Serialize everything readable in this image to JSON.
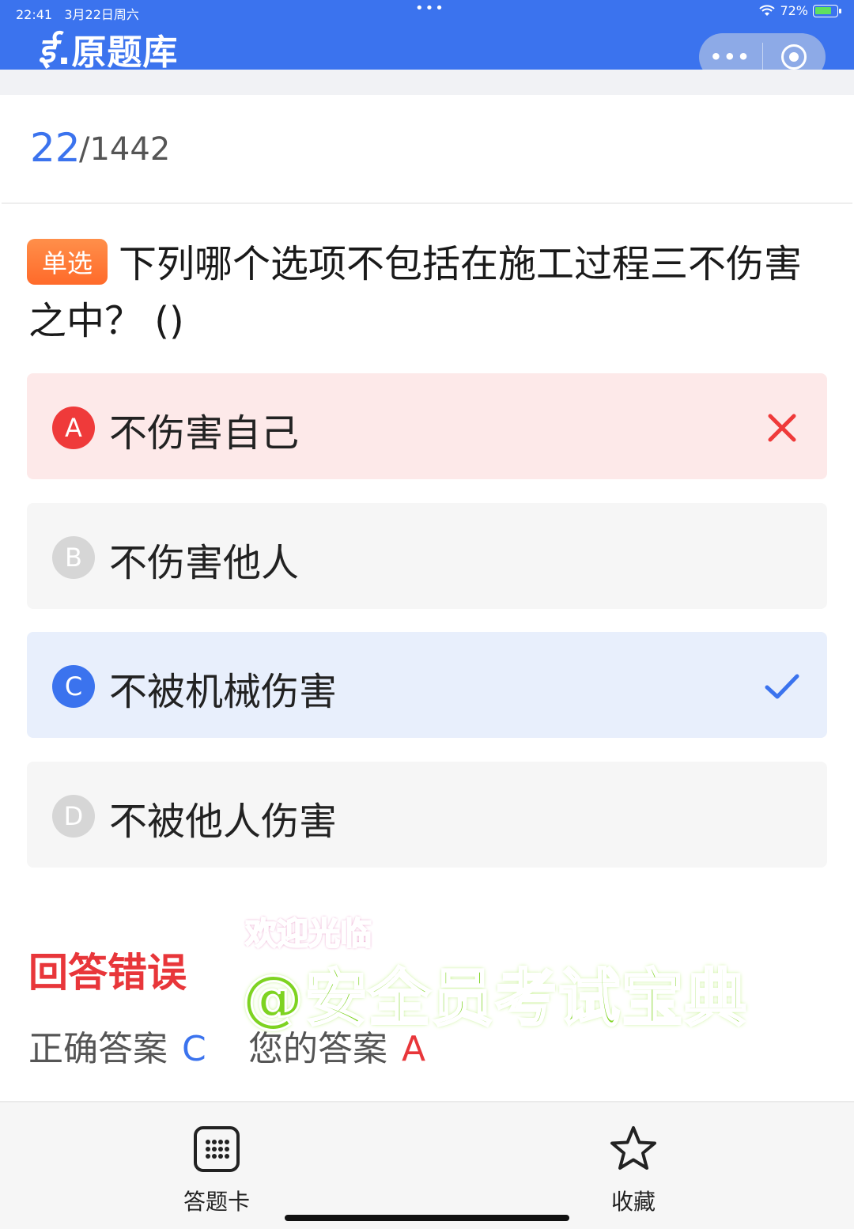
{
  "status_bar": {
    "time": "22:41",
    "date": "3月22日周六",
    "dots": "•••",
    "battery_percent": "72%"
  },
  "header": {
    "logo_glyph": "ई",
    "title": ".原题库",
    "more_icon": "•••",
    "bg_color": "#3b73ee"
  },
  "progress": {
    "current": "22",
    "total": "/1442"
  },
  "question": {
    "type_tag": "单选",
    "text": "下列哪个选项不包括在施工过程三不伤害之中？ ()"
  },
  "options": [
    {
      "letter": "A",
      "text": "不伤害自己",
      "state": "wrong"
    },
    {
      "letter": "B",
      "text": "不伤害他人",
      "state": "normal"
    },
    {
      "letter": "C",
      "text": "不被机械伤害",
      "state": "right"
    },
    {
      "letter": "D",
      "text": "不被他人伤害",
      "state": "normal"
    }
  ],
  "result": {
    "title": "回答错误",
    "correct_label": "正确答案",
    "correct_value": "C",
    "your_label": "您的答案",
    "your_value": "A"
  },
  "watermark": {
    "small": "欢迎光临",
    "big": "@安全员考试宝典"
  },
  "bottom_bar": {
    "card_label": "答题卡",
    "fav_label": "收藏"
  },
  "colors": {
    "accent": "#3b73ee",
    "error": "#e8363a",
    "tag": "#ff7a35"
  }
}
